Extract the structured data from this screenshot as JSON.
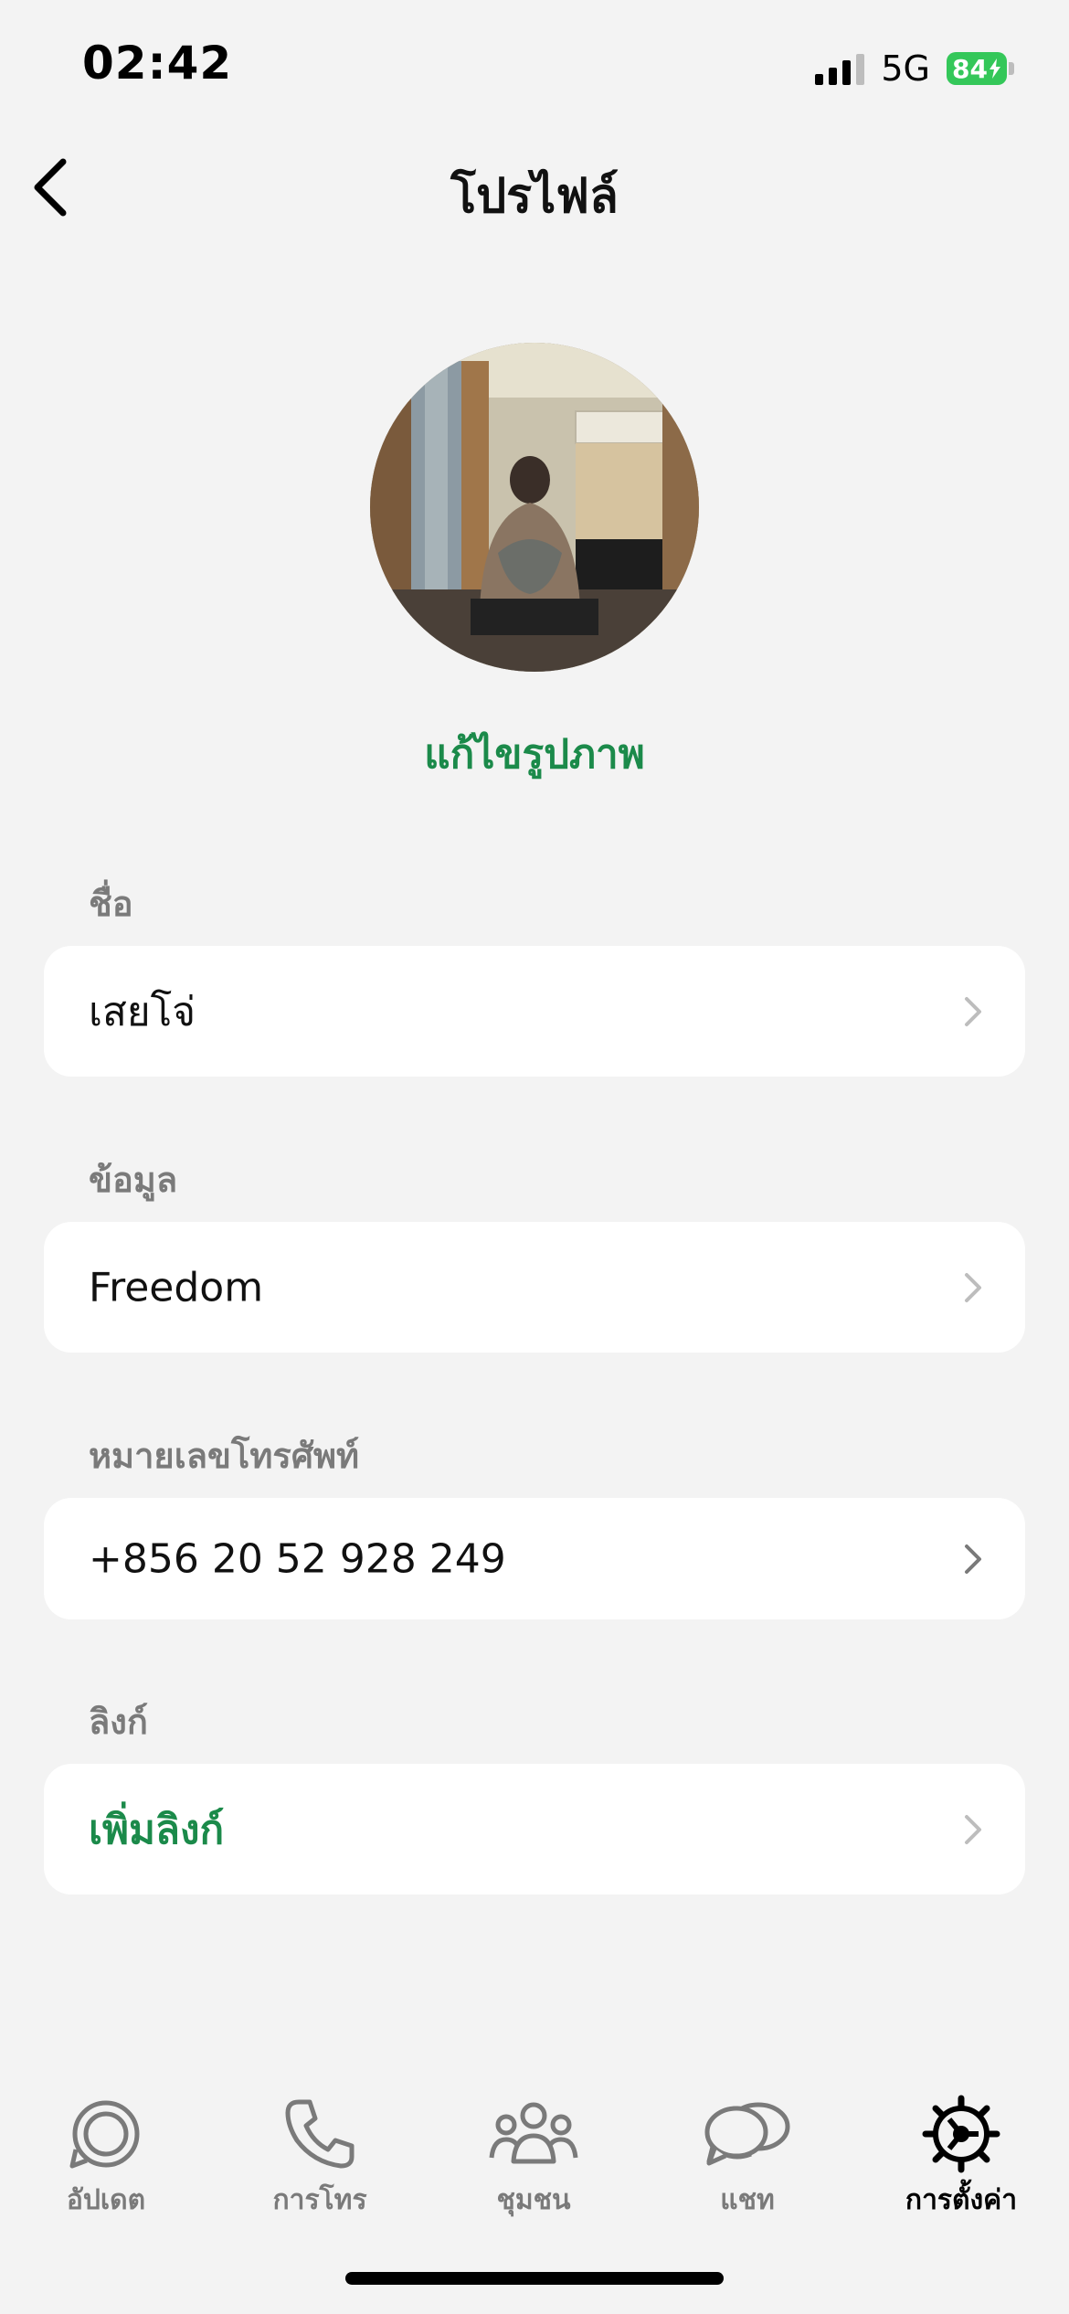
{
  "status_bar": {
    "time": "02:42",
    "network": "5G",
    "battery": "84"
  },
  "header": {
    "title": "โปรไฟล์"
  },
  "profile": {
    "edit_photo_label": "แก้ไขรูปภาพ"
  },
  "fields": [
    {
      "label": "ชื่อ",
      "value": "เสยโจ่"
    },
    {
      "label": "ข้อมูล",
      "value": "Freedom"
    },
    {
      "label": "หมายเลขโทรศัพท์",
      "value": "+856 20 52 928 249"
    },
    {
      "label": "ลิงก์",
      "value": "เพิ่มลิงก์"
    }
  ],
  "tabs": [
    {
      "label": "อัปเดต",
      "icon": "updates-icon"
    },
    {
      "label": "การโทร",
      "icon": "phone-icon"
    },
    {
      "label": "ชุมชน",
      "icon": "community-icon"
    },
    {
      "label": "แชท",
      "icon": "chat-icon"
    },
    {
      "label": "การตั้งค่า",
      "icon": "settings-icon"
    }
  ],
  "colors": {
    "accent": "#1b8a4a",
    "background": "#f3f3f3",
    "card": "#ffffff",
    "muted": "#7a7a7a"
  }
}
